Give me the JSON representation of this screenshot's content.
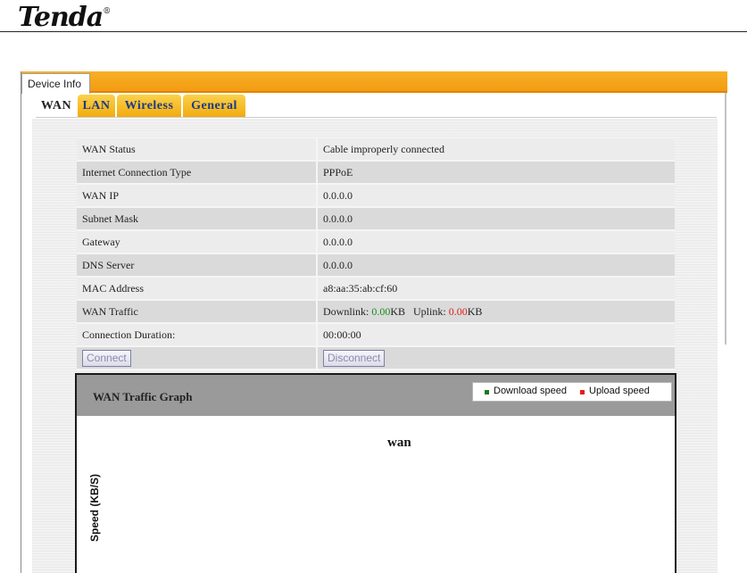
{
  "brand": {
    "name": "Tenda",
    "mark": "®"
  },
  "window": {
    "tab_title": "Device Info"
  },
  "tabs": [
    {
      "label": "WAN",
      "active": true
    },
    {
      "label": "LAN",
      "active": false
    },
    {
      "label": "Wireless",
      "active": false
    },
    {
      "label": "General",
      "active": false
    }
  ],
  "wan_info": {
    "rows": [
      {
        "label": "WAN Status",
        "value": "Cable improperly connected"
      },
      {
        "label": "Internet Connection Type",
        "value": "PPPoE"
      },
      {
        "label": "WAN IP",
        "value": "0.0.0.0"
      },
      {
        "label": "Subnet Mask",
        "value": "0.0.0.0"
      },
      {
        "label": "Gateway",
        "value": "0.0.0.0"
      },
      {
        "label": "DNS Server",
        "value": "0.0.0.0"
      },
      {
        "label": "MAC Address",
        "value": "a8:aa:35:ab:cf:60"
      }
    ],
    "traffic": {
      "label": "WAN Traffic",
      "downlink_label": "Downlink:",
      "downlink_value": "0.00",
      "uplink_label": "Uplink:",
      "uplink_value": "0.00",
      "unit": "KB"
    },
    "duration": {
      "label": "Connection Duration:",
      "value": "00:00:00"
    },
    "buttons": {
      "connect": "Connect",
      "disconnect": "Disconnect"
    }
  },
  "graph": {
    "title": "WAN Traffic Graph",
    "series_title": "wan",
    "ylabel": "Speed (KB/S)",
    "legend": [
      {
        "name": "Download speed",
        "color": "#1a7a1a"
      },
      {
        "name": "Upload speed",
        "color": "#e31b1b"
      }
    ]
  },
  "colors": {
    "accent": "#f29a10",
    "tab_text": "#1a3a8a",
    "status_ok": "#2a8a2a"
  }
}
